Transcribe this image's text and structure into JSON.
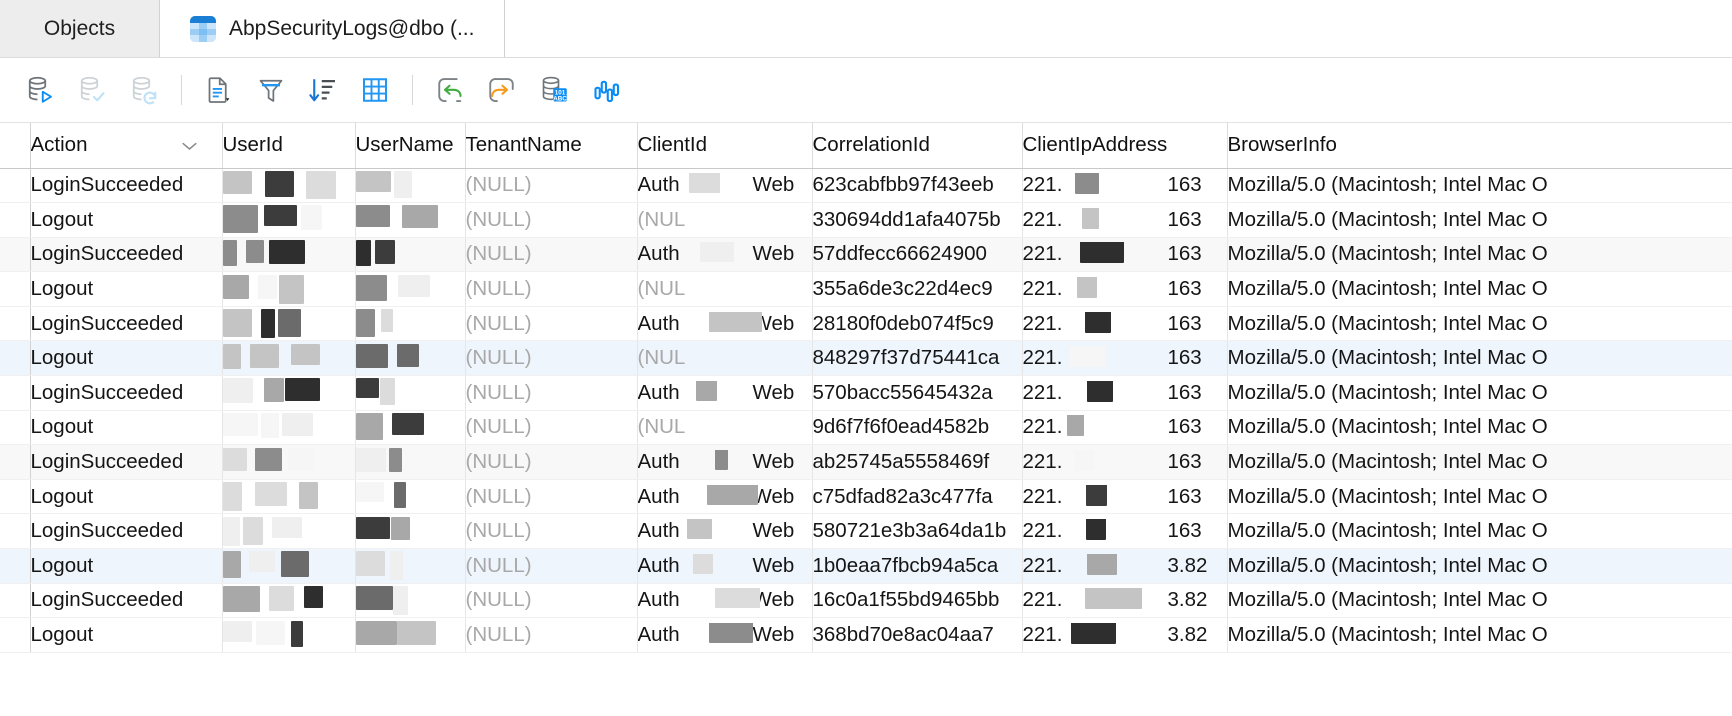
{
  "window": {
    "tabs": [
      {
        "label": "Objects",
        "icon": "",
        "active": false
      },
      {
        "label": "AbpSecurityLogs@dbo (...",
        "icon": "table-icon",
        "active": true
      }
    ]
  },
  "toolbar": {
    "groups": [
      {
        "buttons": [
          {
            "name": "execute-statement",
            "icon": "database-run-icon",
            "enabled": true
          },
          {
            "name": "commit-transaction",
            "icon": "database-commit-icon",
            "enabled": false
          },
          {
            "name": "rollback-transaction",
            "icon": "database-rollback-icon",
            "enabled": false
          }
        ]
      },
      {
        "buttons": [
          {
            "name": "export-data",
            "icon": "document-dropdown-icon",
            "enabled": true
          },
          {
            "name": "filter-rows",
            "icon": "funnel-icon",
            "enabled": true
          },
          {
            "name": "order-rows",
            "icon": "sort-descending-icon",
            "enabled": true
          },
          {
            "name": "grid-presentation",
            "icon": "grid-table-icon",
            "enabled": true
          }
        ]
      },
      {
        "buttons": [
          {
            "name": "navigate-back",
            "icon": "arrow-back-icon",
            "enabled": true
          },
          {
            "name": "navigate-forward",
            "icon": "arrow-forward-icon",
            "enabled": true
          },
          {
            "name": "record-count",
            "icon": "database-101abc-icon",
            "enabled": true
          },
          {
            "name": "value-statistics",
            "icon": "bar-statistics-icon",
            "enabled": true
          }
        ]
      }
    ]
  },
  "grid": {
    "columns": [
      {
        "key": "Action",
        "label": "Action",
        "sort": "chevron-down-icon"
      },
      {
        "key": "UserId",
        "label": "UserId"
      },
      {
        "key": "UserName",
        "label": "UserName"
      },
      {
        "key": "TenantName",
        "label": "TenantName"
      },
      {
        "key": "ClientId",
        "label": "ClientId"
      },
      {
        "key": "CorrelationId",
        "label": "CorrelationId"
      },
      {
        "key": "ClientIpAddress",
        "label": "ClientIpAddress"
      },
      {
        "key": "BrowserInfo",
        "label": "BrowserInfo"
      }
    ],
    "null_text": "(NULL)",
    "null_text_clipped": "(NUL",
    "ip_prefix": "221.",
    "rows": [
      {
        "action": "LoginSucceeded",
        "tenant": "(NULL)",
        "client": "Auth",
        "client_suffix": "Web",
        "correlation": "623cabfbb97f43eeb",
        "ip_suffix": "163",
        "browser": "Mozilla/5.0 (Macintosh; Intel Mac O"
      },
      {
        "action": "Logout",
        "tenant": "(NULL)",
        "client": "(NUL",
        "client_suffix": "",
        "correlation": "330694dd1afa4075b",
        "ip_suffix": "163",
        "browser": "Mozilla/5.0 (Macintosh; Intel Mac O"
      },
      {
        "action": "LoginSucceeded",
        "tenant": "(NULL)",
        "client": "Auth",
        "client_suffix": "Web",
        "correlation": "57ddfecc66624900",
        "ip_suffix": "163",
        "browser": "Mozilla/5.0 (Macintosh; Intel Mac O"
      },
      {
        "action": "Logout",
        "tenant": "(NULL)",
        "client": "(NUL",
        "client_suffix": "",
        "correlation": "355a6de3c22d4ec9",
        "ip_suffix": "163",
        "browser": "Mozilla/5.0 (Macintosh; Intel Mac O"
      },
      {
        "action": "LoginSucceeded",
        "tenant": "(NULL)",
        "client": "Auth",
        "client_suffix": "Web",
        "correlation": "28180f0deb074f5c9",
        "ip_suffix": "163",
        "browser": "Mozilla/5.0 (Macintosh; Intel Mac O"
      },
      {
        "action": "Logout",
        "tenant": "(NULL)",
        "client": "(NUL",
        "client_suffix": "",
        "correlation": "848297f37d75441ca",
        "ip_suffix": "163",
        "browser": "Mozilla/5.0 (Macintosh; Intel Mac O"
      },
      {
        "action": "LoginSucceeded",
        "tenant": "(NULL)",
        "client": "Auth",
        "client_suffix": "Web",
        "correlation": "570bacc55645432a",
        "ip_suffix": "163",
        "browser": "Mozilla/5.0 (Macintosh; Intel Mac O"
      },
      {
        "action": "Logout",
        "tenant": "(NULL)",
        "client": "(NUL",
        "client_suffix": "",
        "correlation": "9d6f7f6f0ead4582b",
        "ip_suffix": "163",
        "browser": "Mozilla/5.0 (Macintosh; Intel Mac O"
      },
      {
        "action": "LoginSucceeded",
        "tenant": "(NULL)",
        "client": "Auth",
        "client_suffix": "Web",
        "correlation": "ab25745a5558469f",
        "ip_suffix": "163",
        "browser": "Mozilla/5.0 (Macintosh; Intel Mac O"
      },
      {
        "action": "Logout",
        "tenant": "(NULL)",
        "client": "Auth",
        "client_suffix": "Web",
        "correlation": "c75dfad82a3c477fa",
        "ip_suffix": "163",
        "browser": "Mozilla/5.0 (Macintosh; Intel Mac O"
      },
      {
        "action": "LoginSucceeded",
        "tenant": "(NULL)",
        "client": "Auth",
        "client_suffix": "Web",
        "correlation": "580721e3b3a64da1b",
        "ip_suffix": "163",
        "browser": "Mozilla/5.0 (Macintosh; Intel Mac O"
      },
      {
        "action": "Logout",
        "tenant": "(NULL)",
        "client": "Auth",
        "client_suffix": "Web",
        "correlation": "1b0eaa7fbcb94a5ca",
        "ip_suffix": "3.82",
        "browser": "Mozilla/5.0 (Macintosh; Intel Mac O"
      },
      {
        "action": "LoginSucceeded",
        "tenant": "(NULL)",
        "client": "Auth",
        "client_suffix": "Web",
        "correlation": "16c0a1f55bd9465bb",
        "ip_suffix": "3.82",
        "browser": "Mozilla/5.0 (Macintosh; Intel Mac O"
      },
      {
        "action": "Logout",
        "tenant": "(NULL)",
        "client": "Auth",
        "client_suffix": "Web",
        "correlation": "368bd70e8ac04aa7",
        "ip_suffix": "3.82",
        "browser": "Mozilla/5.0 (Macintosh; Intel Mac O"
      }
    ]
  },
  "colors": {
    "accent_blue": "#0a8cf5",
    "icon_gray": "#6e7479",
    "icon_disabled": "#c6cbd0",
    "green": "#3fae3f",
    "orange": "#f59b1b",
    "selected_row": "#eef5fc",
    "alt_row": "#f8f8f8"
  }
}
